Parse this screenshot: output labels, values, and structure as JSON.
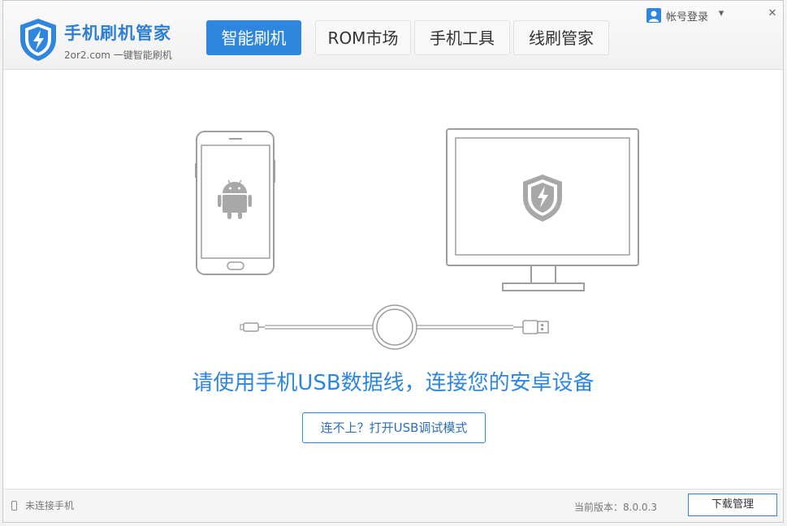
{
  "app": {
    "title": "手机刷机管家",
    "subtitle": "2or2.com 一键智能刷机"
  },
  "tabs": [
    {
      "label": "智能刷机",
      "active": true
    },
    {
      "label": "ROM市场",
      "active": false
    },
    {
      "label": "手机工具",
      "active": false
    },
    {
      "label": "线刷管家",
      "active": false
    }
  ],
  "account": {
    "label": "帐号登录"
  },
  "window_controls": {
    "menu": "▾",
    "close": "✕"
  },
  "main": {
    "instruction": "请使用手机USB数据线，连接您的安卓设备",
    "help_button": "连不上？打开USB调试模式"
  },
  "footer": {
    "status": "未连接手机",
    "version": "当前版本：8.0.0.3",
    "download_button": "下载管理"
  },
  "colors": {
    "accent": "#2e86de",
    "line_art": "#9e9e9e"
  },
  "icons": [
    "shield-bolt-icon",
    "user-icon",
    "android-icon",
    "phone-icon",
    "monitor-icon",
    "usb-cable-icon"
  ]
}
